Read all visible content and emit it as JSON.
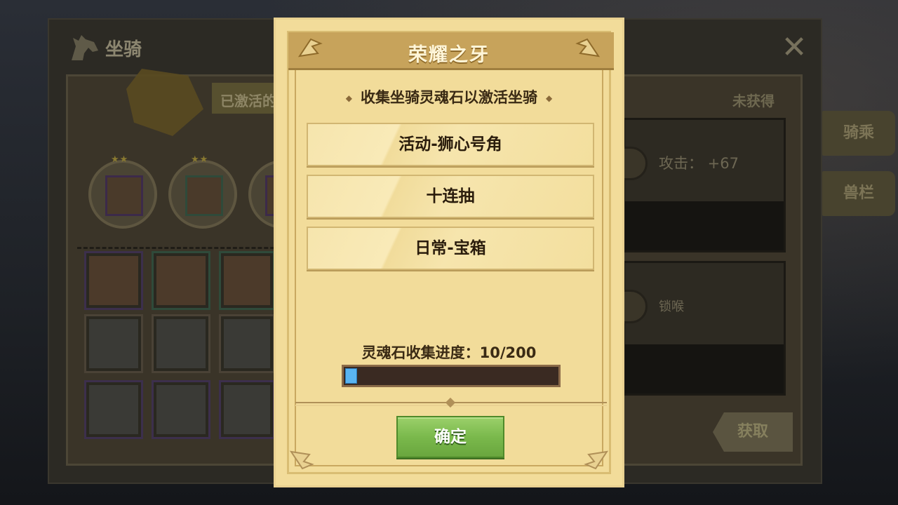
{
  "background": {
    "title": "坐骑",
    "activated_tab": "已激活的",
    "not_obtained": "未获得",
    "stat_attack": "攻击： +67",
    "lock_text": "锁喉",
    "side_tabs": [
      "骑乘",
      "兽栏"
    ],
    "get_button": "获取",
    "stars": "★★"
  },
  "modal": {
    "title": "荣耀之牙",
    "subtitle": "收集坐骑灵魂石以激活坐骑",
    "sources": [
      "活动-狮心号角",
      "十连抽",
      "日常-宝箱"
    ],
    "progress_label": "灵魂石收集进度：10/200",
    "progress_current": 10,
    "progress_max": 200,
    "confirm_button": "确定"
  },
  "colors": {
    "modal_bg": "#f2dc9a",
    "header": "#c7a35b",
    "progress_fill": "#5ab4f0",
    "confirm_green": "#7ab94c"
  }
}
